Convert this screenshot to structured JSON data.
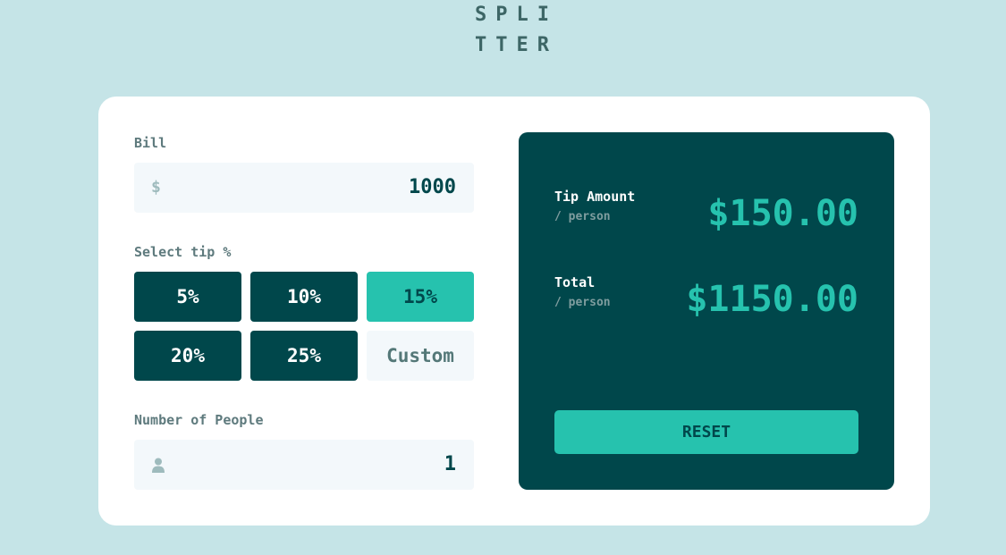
{
  "app": {
    "logo_line1": "SPLI",
    "logo_line2": "TTER"
  },
  "bill": {
    "label": "Bill",
    "currency_symbol": "$",
    "value": "1000"
  },
  "tip": {
    "label": "Select tip %",
    "options": [
      "5%",
      "10%",
      "15%",
      "20%",
      "25%"
    ],
    "selected": "15%",
    "custom_placeholder": "Custom"
  },
  "people": {
    "label": "Number of People",
    "icon": "person-icon",
    "value": "1"
  },
  "results": {
    "tip_amount_label": "Tip Amount",
    "tip_amount_sub": "/ person",
    "tip_amount_value": "$150.00",
    "total_label": "Total",
    "total_sub": "/ person",
    "total_value": "$1150.00",
    "reset_label": "RESET"
  },
  "colors": {
    "background": "#c5e4e7",
    "dark_cyan": "#00474b",
    "strong_cyan": "#26c2ae",
    "white": "#ffffff"
  }
}
